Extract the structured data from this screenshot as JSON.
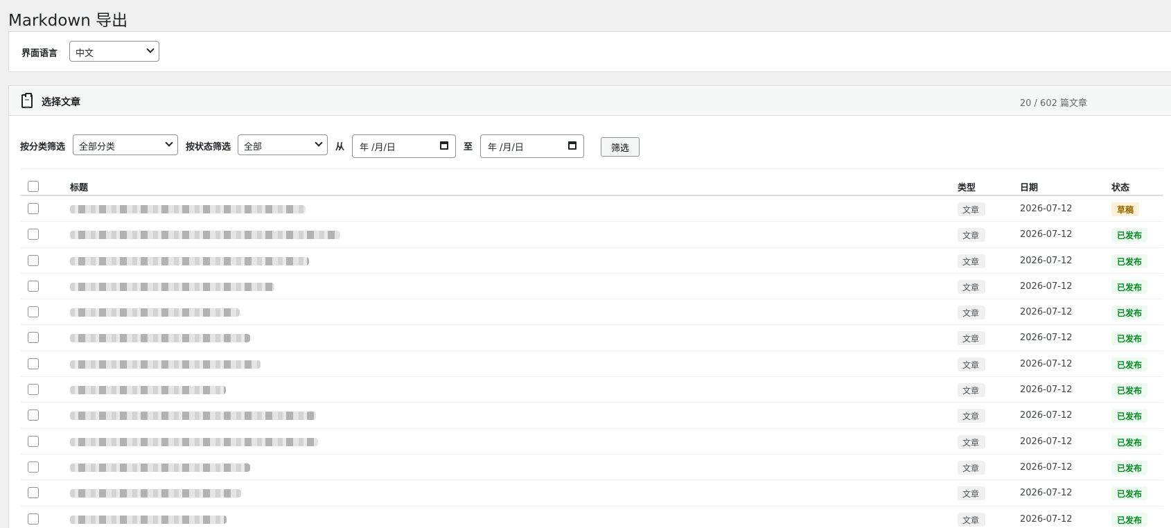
{
  "page": {
    "title": "Markdown 导出"
  },
  "language": {
    "label": "界面语言",
    "value": "中文"
  },
  "articles": {
    "title": "选择文章",
    "count": "20 / 602 篇文章"
  },
  "filters": {
    "category_label": "按分类筛选",
    "category_value": "全部分类",
    "status_label": "按状态筛选",
    "status_value": "全部",
    "from_label": "从",
    "to_label": "至",
    "date_placeholder": "年 /月/日",
    "button": "筛选"
  },
  "table": {
    "headers": {
      "title": "标题",
      "type": "类型",
      "date": "日期",
      "status": "状态"
    },
    "rows": [
      {
        "type": "文章",
        "date": "2026-07-12",
        "status": "草稿"
      },
      {
        "type": "文章",
        "date": "2026-07-12",
        "status": "已发布"
      },
      {
        "type": "文章",
        "date": "2026-07-12",
        "status": "已发布"
      },
      {
        "type": "文章",
        "date": "2026-07-12",
        "status": "已发布"
      },
      {
        "type": "文章",
        "date": "2026-07-12",
        "status": "已发布"
      },
      {
        "type": "文章",
        "date": "2026-07-12",
        "status": "已发布"
      },
      {
        "type": "文章",
        "date": "2026-07-12",
        "status": "已发布"
      },
      {
        "type": "文章",
        "date": "2026-07-12",
        "status": "已发布"
      },
      {
        "type": "文章",
        "date": "2026-07-12",
        "status": "已发布"
      },
      {
        "type": "文章",
        "date": "2026-07-12",
        "status": "已发布"
      },
      {
        "type": "文章",
        "date": "2026-07-12",
        "status": "已发布"
      },
      {
        "type": "文章",
        "date": "2026-07-12",
        "status": "已发布"
      },
      {
        "type": "文章",
        "date": "2026-07-12",
        "status": "已发布"
      }
    ]
  }
}
